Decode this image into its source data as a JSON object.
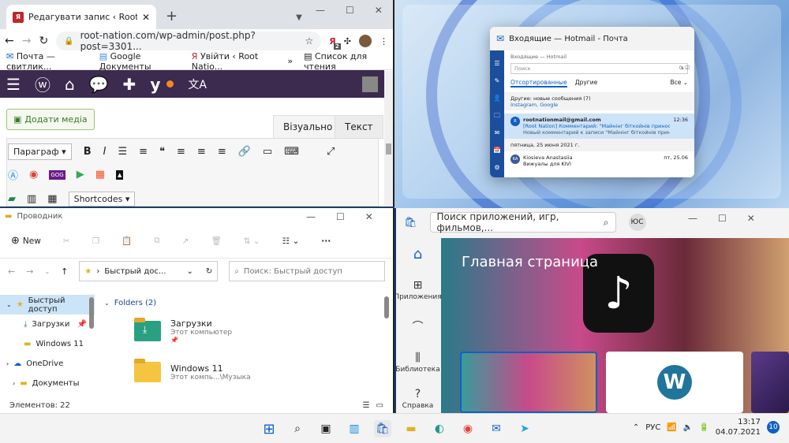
{
  "chrome": {
    "tab_title": "Редагувати запис ‹ Root Nation",
    "url": "root-nation.com/wp-admin/post.php?post=3301...",
    "bookmarks": [
      "Почта — свитлик...",
      "Google Документы",
      "Увійти ‹ Root Natio...",
      "Список для чтения"
    ],
    "ext_badge": "2",
    "add_media": "Додати медіа",
    "tab_visual": "Візуально",
    "tab_text": "Текст",
    "format_select": "Параграф",
    "shortcodes": "Shortcodes"
  },
  "mail": {
    "title": "Входящие — Hotmail - Почта",
    "folder": "Входящие — Hotmail",
    "search_placeholder": "Поиск",
    "tab_focused": "Отсортированные",
    "tab_other": "Другие",
    "filter": "Все",
    "notice_title": "Другие: новые сообщения (7)",
    "notice_sub": "Instagram, Google",
    "msg1_from": "rootnationmail@gmail.com",
    "msg1_subject": "[Root Nation] Комментарий: \"Майнінг біткойнів приносить більш",
    "msg1_time": "12:36",
    "msg1_preview": "Новый комментарий к записи \"Майнінг біткойнів приносить більш",
    "date_header": "пятница, 25 июня 2021 г.",
    "msg2_from": "Kiosieva Anastasiia",
    "msg2_subject": "Вижуалы для KIVI",
    "msg2_time": "пт, 25.06"
  },
  "explorer": {
    "title": "Проводник",
    "new_label": "New",
    "address": "Быстрый дос...",
    "search_placeholder": "Поиск: Быстрый доступ",
    "nav": [
      "Быстрый доступ",
      "Загрузки",
      "Windows 11",
      "OneDrive",
      "Документы"
    ],
    "group_header": "Folders (2)",
    "folders": [
      {
        "name": "Загрузки",
        "sub": "Этот компьютер"
      },
      {
        "name": "Windows 11",
        "sub": "Этот компь...\\Музыка"
      }
    ],
    "status": "Элементов: 22"
  },
  "store": {
    "search_placeholder": "Поиск приложений, игр, фильмов,...",
    "avatar": "ЮС",
    "hero_title": "Главная страница",
    "nav": [
      "Приложения",
      "Библиотека",
      "Справка"
    ]
  },
  "taskbar": {
    "lang": "РУС",
    "time": "13:17",
    "date": "04.07.2021",
    "notif_count": "10"
  }
}
